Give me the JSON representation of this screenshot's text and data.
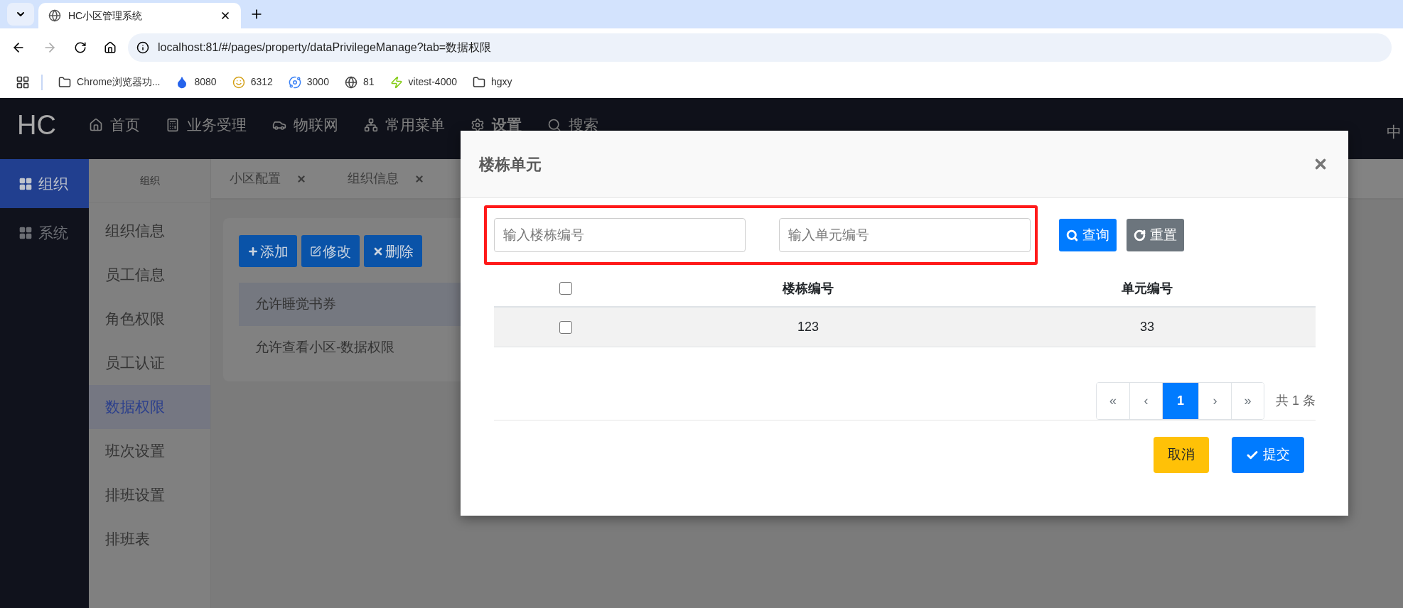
{
  "browser": {
    "tab_title": "HC小区管理系统",
    "url": "localhost:81/#/pages/property/dataPrivilegeManage?tab=数据权限",
    "bookmarks": [
      {
        "label": "Chrome浏览器功...",
        "kind": "folder"
      },
      {
        "label": "8080",
        "kind": "droplet"
      },
      {
        "label": "6312",
        "kind": "figure"
      },
      {
        "label": "3000",
        "kind": "planet"
      },
      {
        "label": "81",
        "kind": "globe"
      },
      {
        "label": "vitest-4000",
        "kind": "bolt"
      },
      {
        "label": "hgxy",
        "kind": "folder"
      }
    ]
  },
  "app": {
    "logo": "HC",
    "nav": [
      {
        "label": "首页",
        "kind": "home"
      },
      {
        "label": "业务受理",
        "kind": "calculator"
      },
      {
        "label": "物联网",
        "kind": "car"
      },
      {
        "label": "常用菜单",
        "kind": "sitemap"
      },
      {
        "label": "设置",
        "kind": "gear"
      },
      {
        "label": "搜索",
        "kind": "search"
      }
    ],
    "nav_right": "中",
    "side_menu": [
      {
        "label": "组织",
        "selected": true
      },
      {
        "label": "系统",
        "selected": false
      }
    ],
    "sub_menu": {
      "title": "组织",
      "items": [
        {
          "label": "组织信息",
          "selected": false
        },
        {
          "label": "员工信息",
          "selected": false
        },
        {
          "label": "角色权限",
          "selected": false
        },
        {
          "label": "员工认证",
          "selected": false
        },
        {
          "label": "数据权限",
          "selected": true
        },
        {
          "label": "班次设置",
          "selected": false
        },
        {
          "label": "排班设置",
          "selected": false
        },
        {
          "label": "排班表",
          "selected": false
        }
      ]
    },
    "tabs": [
      {
        "label": "小区配置"
      },
      {
        "label": "组织信息"
      }
    ],
    "toolbar": [
      {
        "label": "添加",
        "kind": "add"
      },
      {
        "label": "修改",
        "kind": "edit"
      },
      {
        "label": "删除",
        "kind": "delete"
      }
    ],
    "list": [
      {
        "label": "允许睡觉书券",
        "selected": true
      },
      {
        "label": "允许查看小区-数据权限",
        "selected": false
      }
    ]
  },
  "modal": {
    "title": "楼栋单元",
    "fields": [
      {
        "placeholder": "输入楼栋编号"
      },
      {
        "placeholder": "输入单元编号"
      }
    ],
    "buttons": [
      {
        "label": "查询",
        "kind": "search"
      },
      {
        "label": "重置",
        "kind": "reset"
      }
    ],
    "table": {
      "header_checked": false,
      "columns": [
        "楼栋编号",
        "单元编号"
      ],
      "rows": [
        {
          "checked": false,
          "cells": [
            "123",
            "33"
          ]
        }
      ]
    },
    "pagination": {
      "pages": [
        {
          "label": "«",
          "selected": false
        },
        {
          "label": "‹",
          "selected": false
        },
        {
          "label": "1",
          "selected": true
        },
        {
          "label": "›",
          "selected": false
        },
        {
          "label": "»",
          "selected": false
        }
      ],
      "total": "共 1 条"
    },
    "footer": [
      {
        "label": "取消",
        "kind": "cancel"
      },
      {
        "label": "提交",
        "kind": "submit"
      }
    ]
  }
}
